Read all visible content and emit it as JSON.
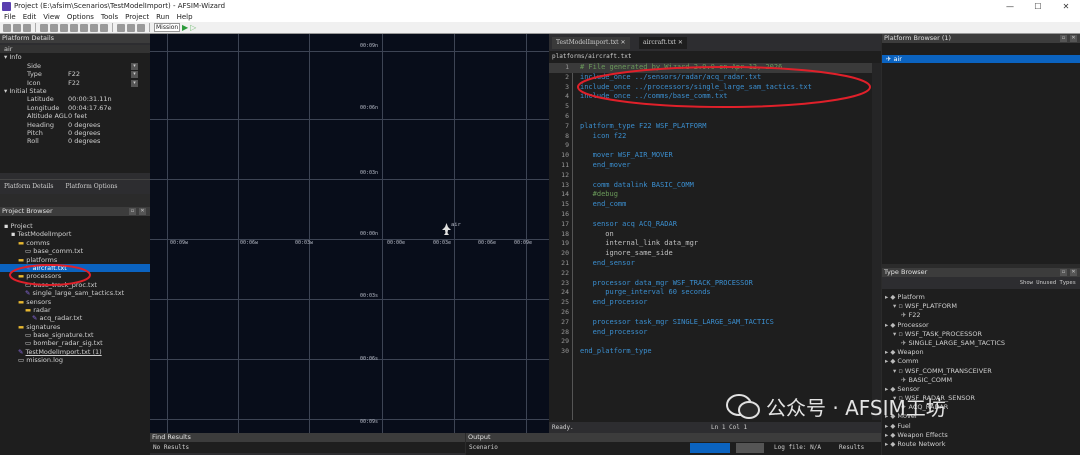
{
  "window": {
    "title": "Project (E:\\afsim\\Scenarios\\TestModelImport) - AFSIM-Wizard",
    "controls": [
      "—",
      "☐",
      "✕"
    ]
  },
  "menu": [
    "File",
    "Edit",
    "View",
    "Options",
    "Tools",
    "Project",
    "Run",
    "Help"
  ],
  "toolbar": {
    "mission_label": "Mission"
  },
  "platform_details": {
    "title": "Platform Details",
    "name": "air",
    "info_header": "Info",
    "info": [
      {
        "label": "Side",
        "value": ""
      },
      {
        "label": "Type",
        "value": "F22"
      },
      {
        "label": "Icon",
        "value": "F22"
      }
    ],
    "state_header": "Initial State",
    "state": [
      {
        "label": "Latitude",
        "value": "00:00:31.11n"
      },
      {
        "label": "Longitude",
        "value": "00:04:17.67e"
      },
      {
        "label": "Altitude AGL",
        "value": "0 feet"
      },
      {
        "label": "Heading",
        "value": "0 degrees"
      },
      {
        "label": "Pitch",
        "value": "0 degrees"
      },
      {
        "label": "Roll",
        "value": "0 degrees"
      }
    ],
    "tabs": [
      "Platform Details",
      "Platform Options"
    ]
  },
  "project_browser": {
    "title": "Project Browser",
    "items": [
      {
        "label": "Project",
        "indent": 0,
        "icon": "project"
      },
      {
        "label": "TestModelImport",
        "indent": 1,
        "icon": "project"
      },
      {
        "label": "comms",
        "indent": 2,
        "icon": "folder"
      },
      {
        "label": "base_comm.txt",
        "indent": 3,
        "icon": "file"
      },
      {
        "label": "platforms",
        "indent": 2,
        "icon": "folder"
      },
      {
        "label": "aircraft.txt",
        "indent": 3,
        "icon": "file-edit",
        "selected": true
      },
      {
        "label": "processors",
        "indent": 2,
        "icon": "folder"
      },
      {
        "label": "base_track_proc.txt",
        "indent": 3,
        "icon": "file"
      },
      {
        "label": "single_large_sam_tactics.txt",
        "indent": 3,
        "icon": "file-edit"
      },
      {
        "label": "sensors",
        "indent": 2,
        "icon": "folder"
      },
      {
        "label": "radar",
        "indent": 3,
        "icon": "folder"
      },
      {
        "label": "acq_radar.txt",
        "indent": 4,
        "icon": "file-edit"
      },
      {
        "label": "signatures",
        "indent": 2,
        "icon": "folder"
      },
      {
        "label": "base_signature.txt",
        "indent": 3,
        "icon": "file"
      },
      {
        "label": "bomber_radar_sig.txt",
        "indent": 3,
        "icon": "file"
      },
      {
        "label": "TestModelImport.txt (1)",
        "indent": 2,
        "icon": "file-edit",
        "link": true
      },
      {
        "label": "mission.log",
        "indent": 2,
        "icon": "file"
      }
    ]
  },
  "map": {
    "top_labels": [
      "00:09n",
      "00:06n",
      "00:03n",
      "00:00n",
      "00:03s",
      "00:06s",
      "00:09s"
    ],
    "axis_labels": [
      "00:09w",
      "00:06w",
      "00:03w",
      "00:00e",
      "00:03e",
      "00:06e",
      "00:09e"
    ],
    "platform_label": "air"
  },
  "editor": {
    "tabs": [
      "TestModelImport.txt",
      "aircraft.txt"
    ],
    "path": "platforms/aircraft.txt",
    "lines": [
      {
        "n": "1",
        "t": "# File generated by Wizard 2.9.0 on Apr 12, 2026.",
        "c": "cm"
      },
      {
        "n": "2",
        "t": "include_once ../sensors/radar/acq_radar.txt",
        "c": "kw"
      },
      {
        "n": "3",
        "t": "include_once ../processors/single_large_sam_tactics.txt",
        "c": "kw"
      },
      {
        "n": "4",
        "t": "include_once ../comms/base_comm.txt",
        "c": "kw"
      },
      {
        "n": "5",
        "t": "",
        "c": "id"
      },
      {
        "n": "6",
        "t": "",
        "c": "id"
      },
      {
        "n": "7",
        "t": "platform_type F22 WSF_PLATFORM",
        "c": "kw"
      },
      {
        "n": "8",
        "t": "   icon f22",
        "c": "kw"
      },
      {
        "n": "9",
        "t": "",
        "c": "id"
      },
      {
        "n": "10",
        "t": "   mover WSF_AIR_MOVER",
        "c": "kw"
      },
      {
        "n": "11",
        "t": "   end_mover",
        "c": "kw"
      },
      {
        "n": "12",
        "t": "",
        "c": "id"
      },
      {
        "n": "13",
        "t": "   comm datalink BASIC_COMM",
        "c": "kw"
      },
      {
        "n": "14",
        "t": "   #debug",
        "c": "cm"
      },
      {
        "n": "15",
        "t": "   end_comm",
        "c": "kw"
      },
      {
        "n": "16",
        "t": "",
        "c": "id"
      },
      {
        "n": "17",
        "t": "   sensor acq ACQ_RADAR",
        "c": "kw"
      },
      {
        "n": "18",
        "t": "      on",
        "c": "id"
      },
      {
        "n": "19",
        "t": "      internal_link data_mgr",
        "c": "id"
      },
      {
        "n": "20",
        "t": "      ignore_same_side",
        "c": "id"
      },
      {
        "n": "21",
        "t": "   end_sensor",
        "c": "kw"
      },
      {
        "n": "22",
        "t": "",
        "c": "id"
      },
      {
        "n": "23",
        "t": "   processor data_mgr WSF_TRACK_PROCESSOR",
        "c": "kw"
      },
      {
        "n": "24",
        "t": "      purge_interval 60 seconds",
        "c": "kw"
      },
      {
        "n": "25",
        "t": "   end_processor",
        "c": "kw"
      },
      {
        "n": "26",
        "t": "",
        "c": "id"
      },
      {
        "n": "27",
        "t": "   processor task_mgr SINGLE_LARGE_SAM_TACTICS",
        "c": "kw"
      },
      {
        "n": "28",
        "t": "   end_processor",
        "c": "kw"
      },
      {
        "n": "29",
        "t": "",
        "c": "id"
      },
      {
        "n": "30",
        "t": "end_platform_type",
        "c": "kw"
      }
    ],
    "status_left": "Ready.",
    "status_right": "Ln 1 Col 1"
  },
  "platform_browser": {
    "title": "Platform Browser (1)",
    "items": [
      "air"
    ]
  },
  "type_browser": {
    "title": "Type Browser",
    "show_unused": "Show Unused Types",
    "items": [
      {
        "label": "Platform",
        "indent": 0
      },
      {
        "label": "WSF_PLATFORM",
        "indent": 1
      },
      {
        "label": "F22",
        "indent": 2
      },
      {
        "label": "Processor",
        "indent": 0
      },
      {
        "label": "WSF_TASK_PROCESSOR",
        "indent": 1
      },
      {
        "label": "SINGLE_LARGE_SAM_TACTICS",
        "indent": 2
      },
      {
        "label": "Weapon",
        "indent": 0
      },
      {
        "label": "Comm",
        "indent": 0
      },
      {
        "label": "WSF_COMM_TRANSCEIVER",
        "indent": 1
      },
      {
        "label": "BASIC_COMM",
        "indent": 2
      },
      {
        "label": "Sensor",
        "indent": 0
      },
      {
        "label": "WSF_RADAR_SENSOR",
        "indent": 1
      },
      {
        "label": "ACQ_RADAR",
        "indent": 2
      },
      {
        "label": "Mover",
        "indent": 0
      },
      {
        "label": "Fuel",
        "indent": 0
      },
      {
        "label": "Weapon Effects",
        "indent": 0
      },
      {
        "label": "Route Network",
        "indent": 0
      }
    ]
  },
  "find_results": {
    "title": "Find Results",
    "body": "No Results"
  },
  "output": {
    "title": "Output",
    "body": "Scenario",
    "log_file": "Log file: N/A",
    "results": "Results"
  },
  "watermark": "公众号 · AFSIM工坊",
  "colors": {
    "accent": "#0b63c0",
    "annotation": "#e0202a",
    "code_keyword": "#3b8fd0"
  }
}
